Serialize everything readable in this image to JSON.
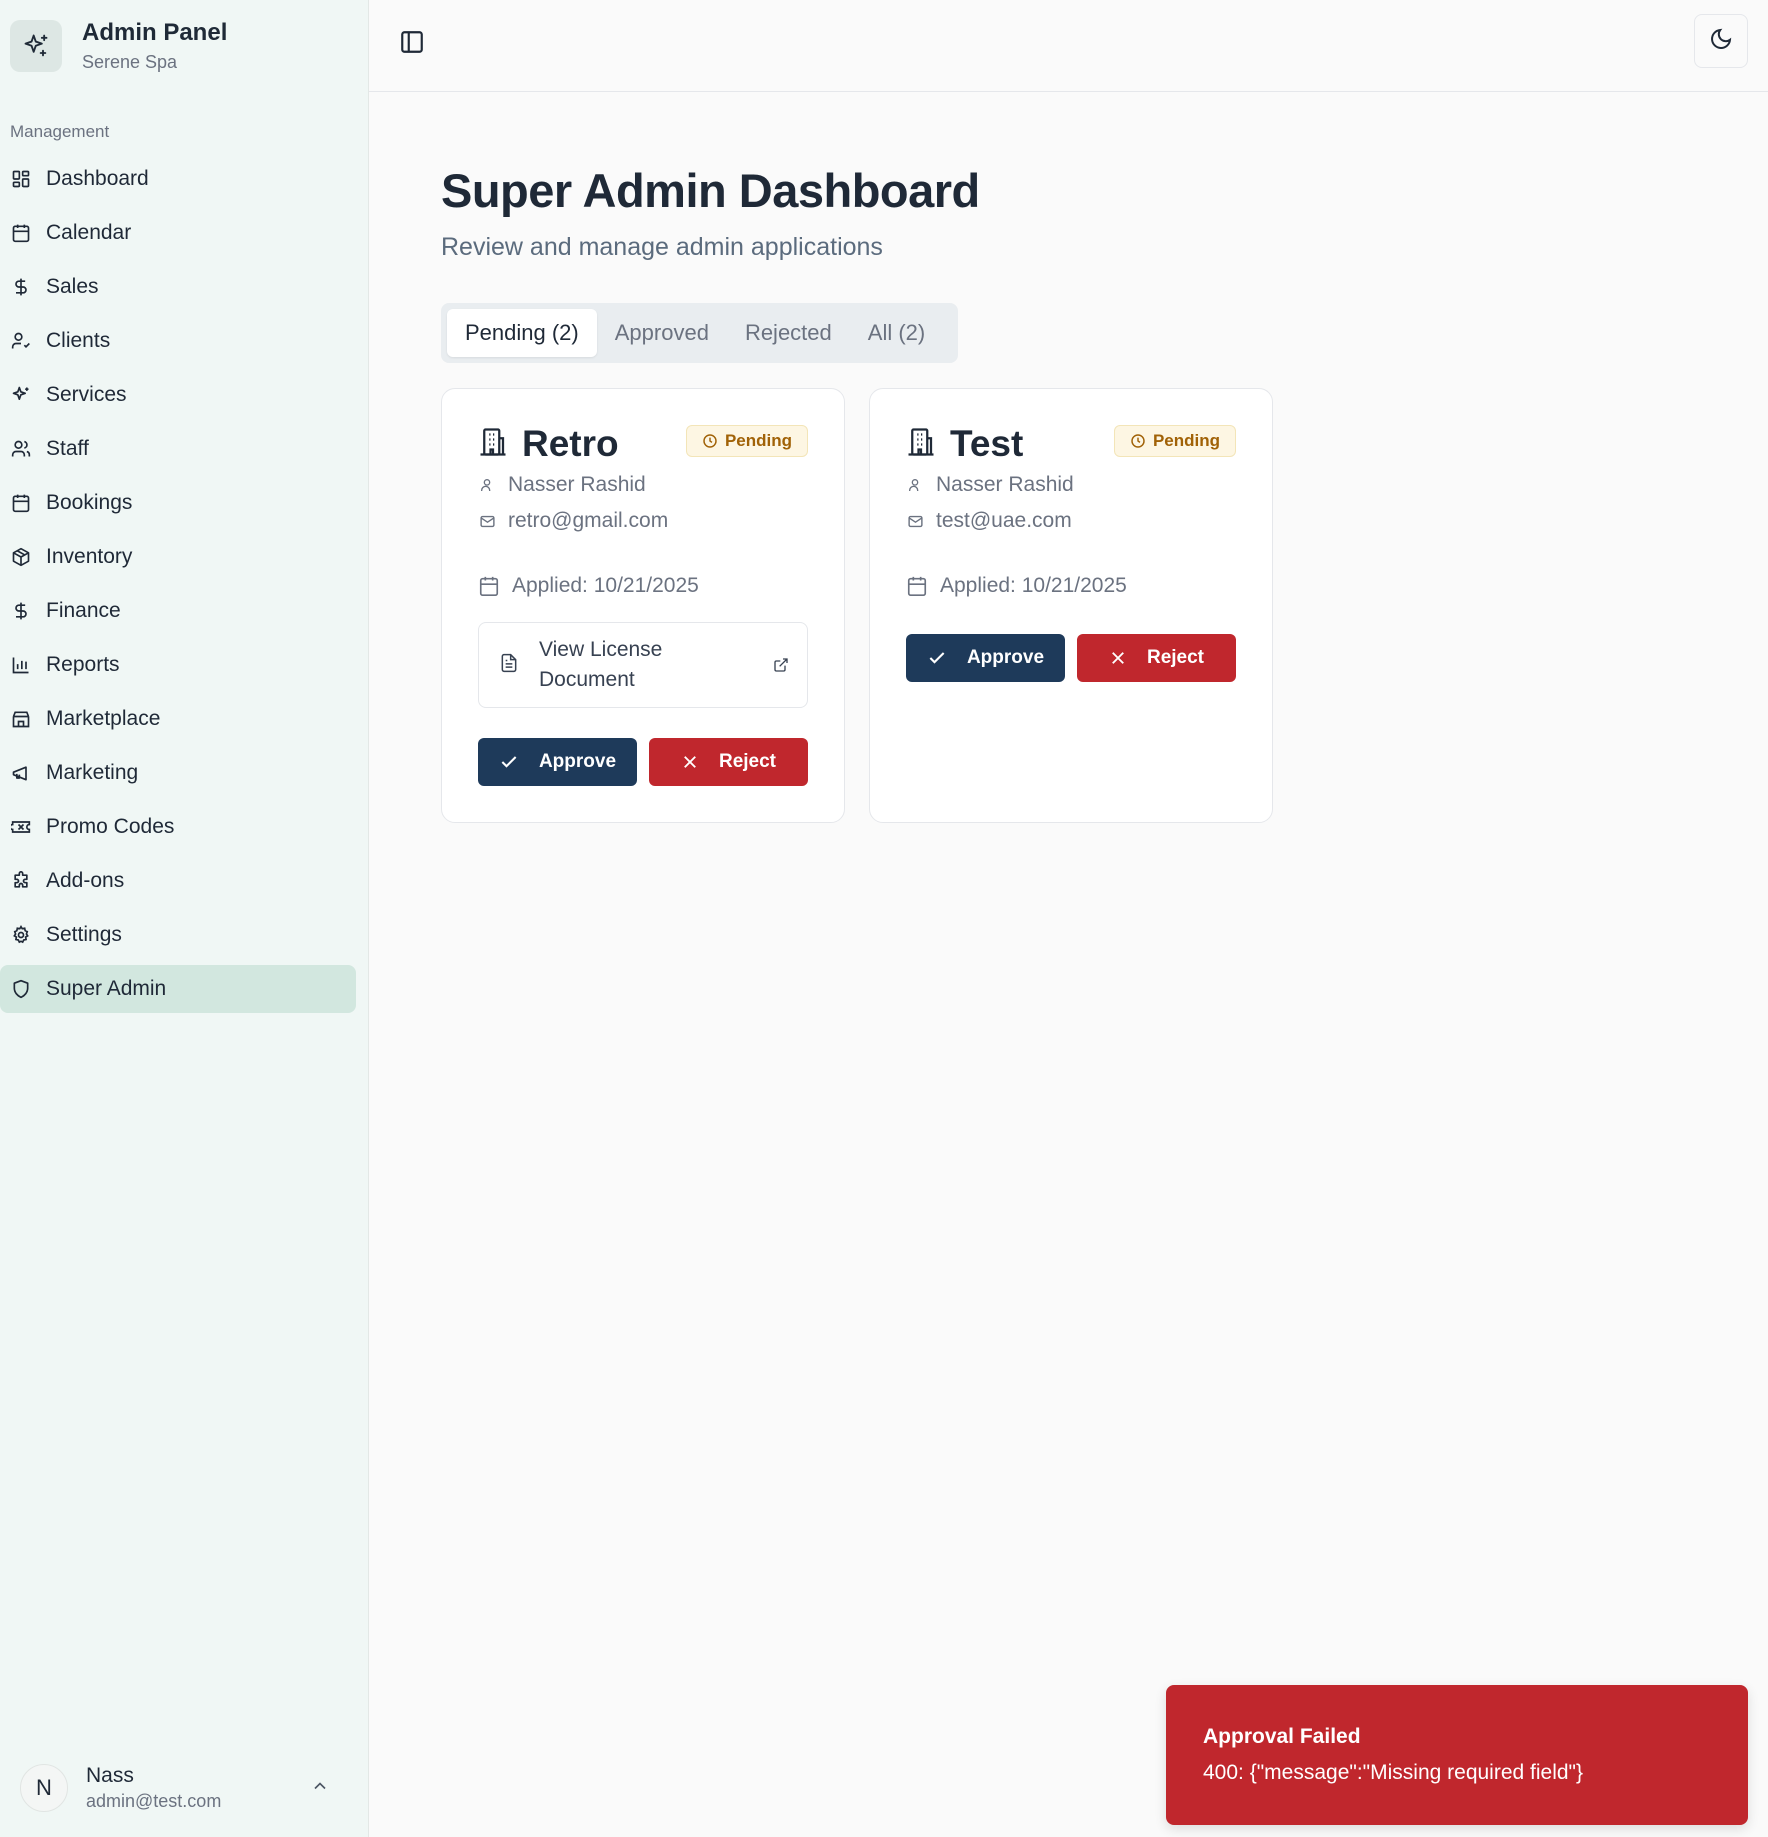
{
  "brand": {
    "title": "Admin Panel",
    "subtitle": "Serene Spa"
  },
  "sidebar": {
    "section_label": "Management",
    "items": [
      {
        "label": "Dashboard",
        "icon": "dashboard-icon"
      },
      {
        "label": "Calendar",
        "icon": "calendar-icon"
      },
      {
        "label": "Sales",
        "icon": "dollar-icon"
      },
      {
        "label": "Clients",
        "icon": "user-check-icon"
      },
      {
        "label": "Services",
        "icon": "sparkles-icon"
      },
      {
        "label": "Staff",
        "icon": "users-icon"
      },
      {
        "label": "Bookings",
        "icon": "calendar-icon"
      },
      {
        "label": "Inventory",
        "icon": "package-icon"
      },
      {
        "label": "Finance",
        "icon": "dollar-icon"
      },
      {
        "label": "Reports",
        "icon": "bar-chart-icon"
      },
      {
        "label": "Marketplace",
        "icon": "store-icon"
      },
      {
        "label": "Marketing",
        "icon": "megaphone-icon"
      },
      {
        "label": "Promo Codes",
        "icon": "ticket-icon"
      },
      {
        "label": "Add-ons",
        "icon": "puzzle-icon"
      },
      {
        "label": "Settings",
        "icon": "gear-icon"
      },
      {
        "label": "Super Admin",
        "icon": "shield-icon",
        "active": true
      }
    ]
  },
  "user": {
    "initial": "N",
    "name": "Nass",
    "email": "admin@test.com"
  },
  "main": {
    "title": "Super Admin Dashboard",
    "subtitle": "Review and manage admin applications",
    "tabs": [
      {
        "label": "Pending (2)",
        "active": true
      },
      {
        "label": "Approved"
      },
      {
        "label": "Rejected"
      },
      {
        "label": "All (2)"
      }
    ],
    "cards": [
      {
        "title": "Retro",
        "status": "Pending",
        "owner": "Nasser Rashid",
        "email": "retro@gmail.com",
        "applied": "Applied: 10/21/2025",
        "license_label": "View License Document",
        "approve_label": "Approve",
        "reject_label": "Reject"
      },
      {
        "title": "Test",
        "status": "Pending",
        "owner": "Nasser Rashid",
        "email": "test@uae.com",
        "applied": "Applied: 10/21/2025",
        "approve_label": "Approve",
        "reject_label": "Reject"
      }
    ]
  },
  "toast": {
    "title": "Approval Failed",
    "message": "400: {\"message\":\"Missing required field\"}"
  },
  "colors": {
    "sidebar_bg": "#f0f7f5",
    "active_item": "#d2e7df",
    "approve": "#1e3a5a",
    "reject": "#c0272d",
    "badge_text": "#a16207"
  }
}
